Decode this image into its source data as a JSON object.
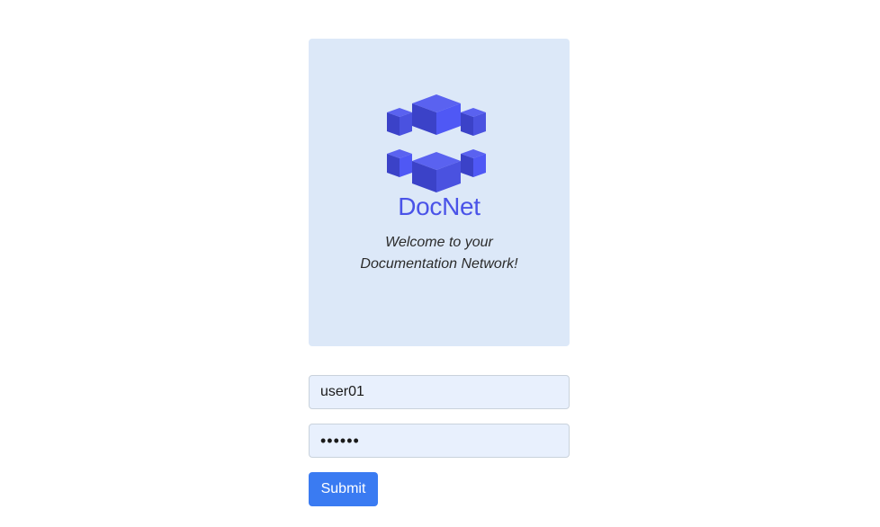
{
  "brand": {
    "name": "DocNet",
    "tagline_line1": "Welcome to your",
    "tagline_line2": "Documentation Network!",
    "logo_icon": "cubes-logo-icon",
    "accent_color": "#4a53e8",
    "card_color": "#dce8f8"
  },
  "login": {
    "username_value": "user01",
    "password_value": "••••••",
    "submit_label": "Submit",
    "button_color": "#3a7bf2"
  }
}
